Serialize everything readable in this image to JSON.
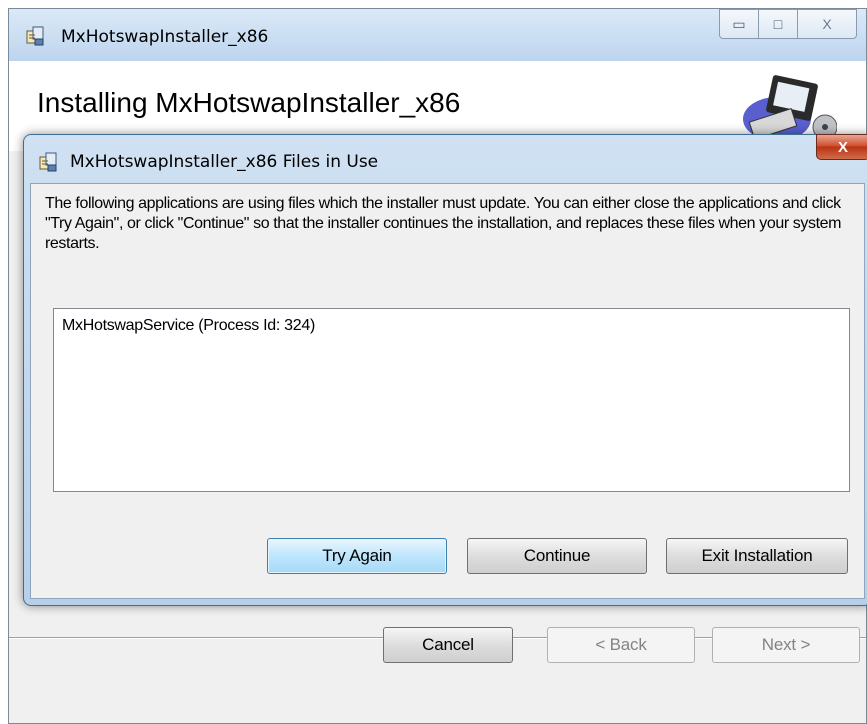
{
  "main_window": {
    "title": "MxHotswapInstaller_x86",
    "caption_minimize": "▭",
    "caption_maximize": "□",
    "caption_close": "X",
    "heading": "Installing MxHotswapInstaller_x86",
    "buttons": {
      "cancel": "Cancel",
      "back": "< Back",
      "next": "Next >"
    }
  },
  "dialog": {
    "title": "MxHotswapInstaller_x86 Files in Use",
    "close": "X",
    "message": "The following applications are using files which the installer must update. You can either close the applications and click \"Try Again\", or click \"Continue\" so that the installer continues the installation, and replaces these files when your system restarts.",
    "processes": [
      "MxHotswapService (Process Id: 324)"
    ],
    "buttons": {
      "try_again": "Try Again",
      "continue": "Continue",
      "exit": "Exit Installation"
    }
  },
  "icons": {
    "installer": "installer-package-icon",
    "computer": "computer-logo-icon"
  },
  "colors": {
    "close_red": "#c9442a",
    "titlebar_blue": "#c9ddf2",
    "focus_blue": "#3c7fb1"
  }
}
